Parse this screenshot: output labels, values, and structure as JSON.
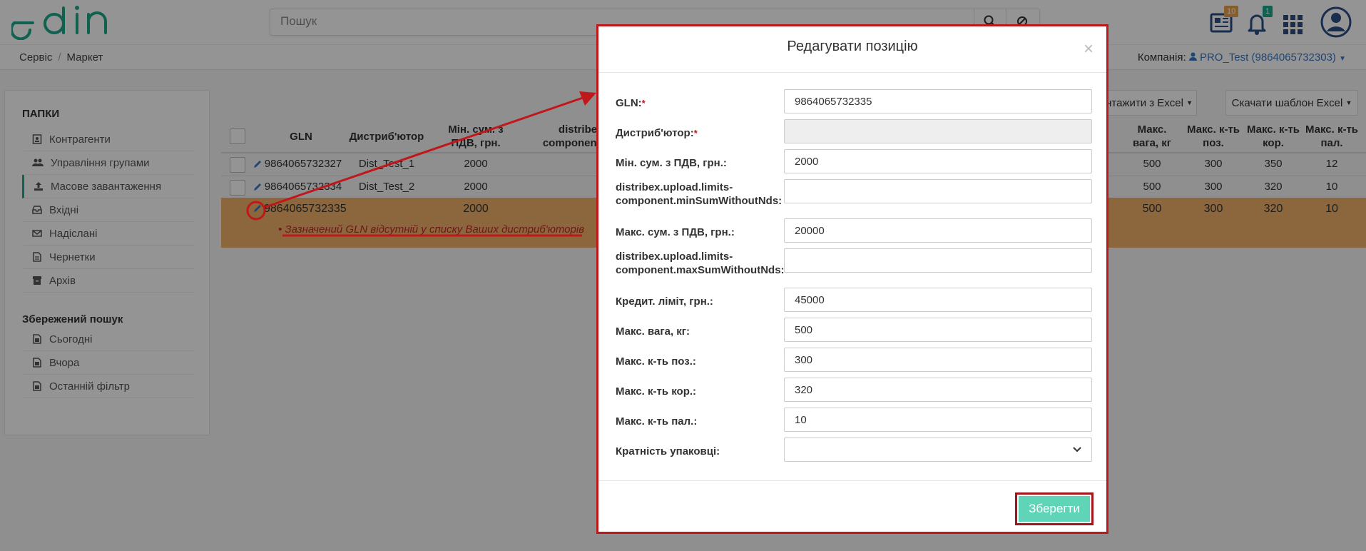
{
  "header": {
    "search_placeholder": "Пошук",
    "news_badge": "10",
    "notifications_badge": "1",
    "brand_color": "#1ca88a"
  },
  "breadcrumb": [
    "Сервіс",
    "Маркет"
  ],
  "company": {
    "label": "Компанія:",
    "value": "PRO_Test (9864065732303)"
  },
  "sidebar": {
    "folders_title": "ПАПКИ",
    "items": [
      {
        "label": "Контрагенти",
        "icon": "contacts-icon"
      },
      {
        "label": "Управління групами",
        "icon": "group-icon"
      },
      {
        "label": "Масове завантаження",
        "icon": "upload-icon",
        "active": true
      },
      {
        "label": "Вхідні",
        "icon": "inbox-icon"
      },
      {
        "label": "Надіслані",
        "icon": "mail-icon"
      },
      {
        "label": "Чернетки",
        "icon": "draft-icon"
      },
      {
        "label": "Архів",
        "icon": "archive-icon"
      }
    ],
    "saved_search_title": "Збережений пошук",
    "saved": [
      {
        "label": "Сьогодні"
      },
      {
        "label": "Вчора"
      },
      {
        "label": "Останній фільтр"
      }
    ]
  },
  "toolbar": {
    "upload_excel": "вантажити з Excel",
    "download_template": "Скачати шаблон Excel"
  },
  "table": {
    "left_headers": {
      "gln": "GLN",
      "distributor": "Дистриб'ютор",
      "min_sum_1": "Мін. сум. з",
      "min_sum_2": "ПДВ, грн.",
      "component_1": "distribe",
      "component_2": "component.m"
    },
    "right_headers": [
      {
        "l1": "Макс.",
        "l2": "вага, кг"
      },
      {
        "l1": "Макс. к-ть",
        "l2": "поз."
      },
      {
        "l1": "Макс. к-ть",
        "l2": "кор."
      },
      {
        "l1": "Макс. к-ть",
        "l2": "пал."
      }
    ],
    "rows": [
      {
        "gln": "9864065732327",
        "distributor": "Dist_Test_1",
        "min_sum": "2000",
        "weight": "500",
        "pos": "300",
        "box": "350",
        "pal": "12"
      },
      {
        "gln": "9864065732334",
        "distributor": "Dist_Test_2",
        "min_sum": "2000",
        "weight": "500",
        "pos": "300",
        "box": "320",
        "pal": "10"
      },
      {
        "gln": "9864065732335",
        "distributor": "",
        "min_sum": "2000",
        "weight": "500",
        "pos": "300",
        "box": "320",
        "pal": "10"
      }
    ],
    "error_message": "Зазначений GLN відсутній у списку Ваших дистриб'юторів"
  },
  "modal": {
    "title": "Редагувати позицію",
    "close": "×",
    "fields": [
      {
        "label": "GLN:",
        "required": true,
        "value": "9864065732335"
      },
      {
        "label": "Дистриб'ютор:",
        "required": true,
        "value": "",
        "disabled": true
      },
      {
        "label": "Мін. сум. з ПДВ, грн.:",
        "value": "2000"
      },
      {
        "label_l1": "distribex.upload.limits-",
        "label_l2": "component.minSumWithoutNds:",
        "value": ""
      },
      {
        "label": "Макс. сум. з ПДВ, грн.:",
        "value": "20000"
      },
      {
        "label_l1": "distribex.upload.limits-",
        "label_l2": "component.maxSumWithoutNds:",
        "value": ""
      },
      {
        "label": "Кредит. ліміт, грн.:",
        "value": "45000"
      },
      {
        "label": "Макс. вага, кг:",
        "value": "500"
      },
      {
        "label": "Макс. к-ть поз.:",
        "value": "300"
      },
      {
        "label": "Макс. к-ть кор.:",
        "value": "320"
      },
      {
        "label": "Макс. к-ть пал.:",
        "value": "10"
      },
      {
        "label": "Кратність упаковці:",
        "value": "",
        "type": "select"
      }
    ],
    "save_label": "Зберегти"
  },
  "colors": {
    "annotation_red": "#c0171b",
    "error_row": "#f2b26c",
    "save_button": "#5fd4b6",
    "link_blue": "#3a76c3"
  }
}
